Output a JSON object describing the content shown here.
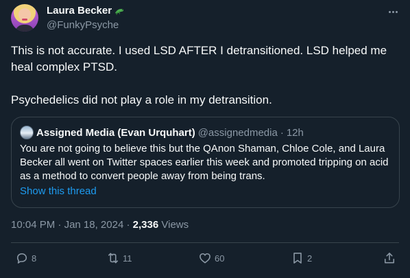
{
  "author": {
    "display_name": "Laura Becker",
    "badge_emoji": "lizard-emoji",
    "handle": "@FunkyPsyche"
  },
  "tweet": {
    "paragraph_1": "This is not accurate. I used LSD AFTER I detransitioned. LSD helped me heal complex PTSD.",
    "paragraph_2": "Psychedelics did not play a role in my detransition."
  },
  "quoted": {
    "display_name": "Assigned Media (Evan Urquhart)",
    "handle": "@assignedmedia",
    "separator": "·",
    "age": "12h",
    "text": "You are not going to believe this but the QAnon Shaman, Chloe Cole, and Laura Becker all went on Twitter spaces earlier this week and promoted tripping on acid as a method to convert people away from being trans.",
    "show_thread": "Show this thread"
  },
  "meta": {
    "time": "10:04 PM",
    "separator": "·",
    "date": "Jan 18, 2024",
    "views_count": "2,336",
    "views_label": "Views"
  },
  "actions": {
    "replies": "8",
    "retweets": "11",
    "likes": "60",
    "bookmarks": "2"
  },
  "colors": {
    "background": "#15202b",
    "text": "#f7f9f9",
    "secondary": "#8b98a5",
    "link": "#1d9bf0",
    "border": "#38444d"
  }
}
